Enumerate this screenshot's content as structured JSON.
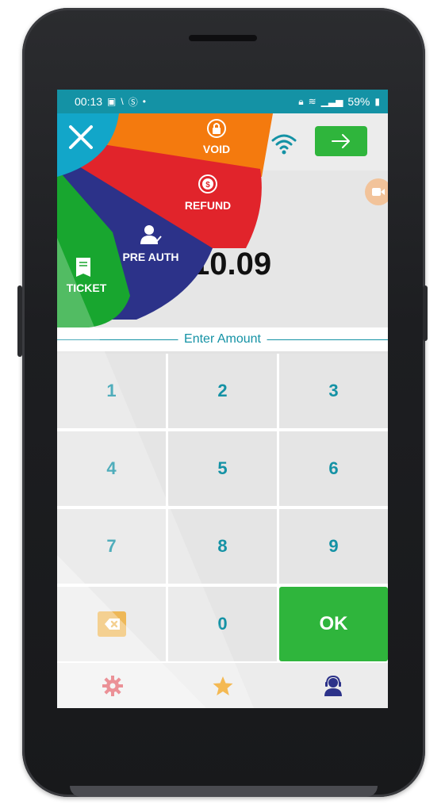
{
  "status_bar": {
    "time": "00:13",
    "battery": "59%"
  },
  "menu": {
    "void_label": "VOID",
    "refund_label": "REFUND",
    "preauth_label": "PRE AUTH",
    "ticket_label": "TICKET"
  },
  "amount": {
    "value": "10.09",
    "enter_label": "Enter Amount"
  },
  "keypad": {
    "keys": [
      "1",
      "2",
      "3",
      "4",
      "5",
      "6",
      "7",
      "8",
      "9"
    ],
    "zero": "0",
    "ok": "OK"
  },
  "colors": {
    "teal": "#1492a5",
    "green": "#2fb53c",
    "void_orange": "#f47a0e",
    "refund_red": "#e1242b",
    "preauth_navy": "#2c3289",
    "ticket_green": "#18a62f",
    "close_cyan": "#12a6c9"
  },
  "icons": {
    "close": "close-icon",
    "wifi": "wifi-icon",
    "next": "arrow-right-icon",
    "video": "video-icon",
    "backspace": "backspace-icon",
    "settings": "gear-icon",
    "favorites": "star-icon",
    "support": "headset-agent-icon"
  }
}
